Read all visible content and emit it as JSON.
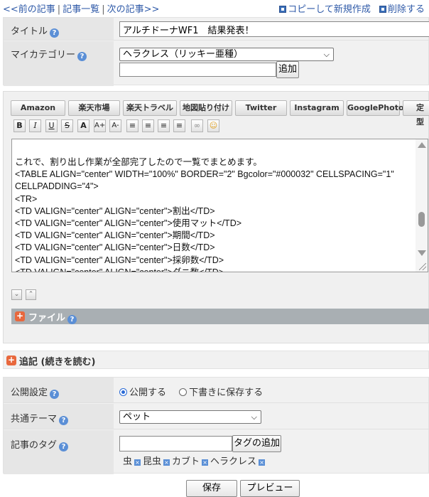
{
  "nav": {
    "prev": "<<前の記事",
    "list": "記事一覧",
    "next": "次の記事>>",
    "sep": "|",
    "copy_new": "コピーして新規作成",
    "delete": "削除する"
  },
  "form": {
    "title_label": "タイトル",
    "title_value": "アルチドーナWF1　結果発表！",
    "category_label": "マイカテゴリー",
    "category_value": "ヘラクレス（リッキー亜種）",
    "category_new_value": "",
    "category_add_button": "追加"
  },
  "toolbar": {
    "buttons": [
      "Amazon",
      "楽天市場",
      "楽天トラベル",
      "地図貼り付け",
      "Twitter",
      "Instagram",
      "GooglePhoto",
      "定型"
    ],
    "format": [
      "B",
      "I",
      "U",
      "S",
      "A",
      "A+",
      "A-",
      "≡",
      "≡",
      "≡",
      "≡",
      "∞",
      "☺"
    ]
  },
  "editor": {
    "lines": [
      "これで、割り出し作業が全部完了したので一覧でまとめます。",
      "<TABLE ALIGN=\"center\" WIDTH=\"100%\" BORDER=\"2\" Bgcolor=\"#000032\" CELLSPACING=\"1\"",
      "CELLPADDING=\"4\">",
      "<TR>",
      "<TD VALIGN=\"center\" ALIGN=\"center\">割出</TD>",
      "<TD VALIGN=\"center\" ALIGN=\"center\">使用マット</TD>",
      "<TD VALIGN=\"center\" ALIGN=\"center\">期間</TD>",
      "<TD VALIGN=\"center\" ALIGN=\"center\">日数</TD>",
      "<TD VALIGN=\"center\" ALIGN=\"center\">採卵数</TD>",
      "<TD VALIGN=\"center\" ALIGN=\"center\">ダニ数</TD>"
    ],
    "file_label": "ファイル"
  },
  "tuiki": {
    "label": "追記 (続きを読む)"
  },
  "settings": {
    "publish_label": "公開設定",
    "publish_options": [
      "公開する",
      "下書きに保存する"
    ],
    "theme_label": "共通テーマ",
    "theme_value": "ペット",
    "tag_label": "記事のタグ",
    "tag_input_value": "",
    "tag_add_button": "タグの追加",
    "tags": [
      "虫",
      "昆虫",
      "カブト",
      "ヘラクレス"
    ]
  },
  "footer": {
    "save_button": "保存",
    "preview_button": "プレビュー"
  },
  "colors": {
    "link": "#2f5aa8",
    "file_bar": "#a9afb3",
    "orange": "#e8683d"
  }
}
